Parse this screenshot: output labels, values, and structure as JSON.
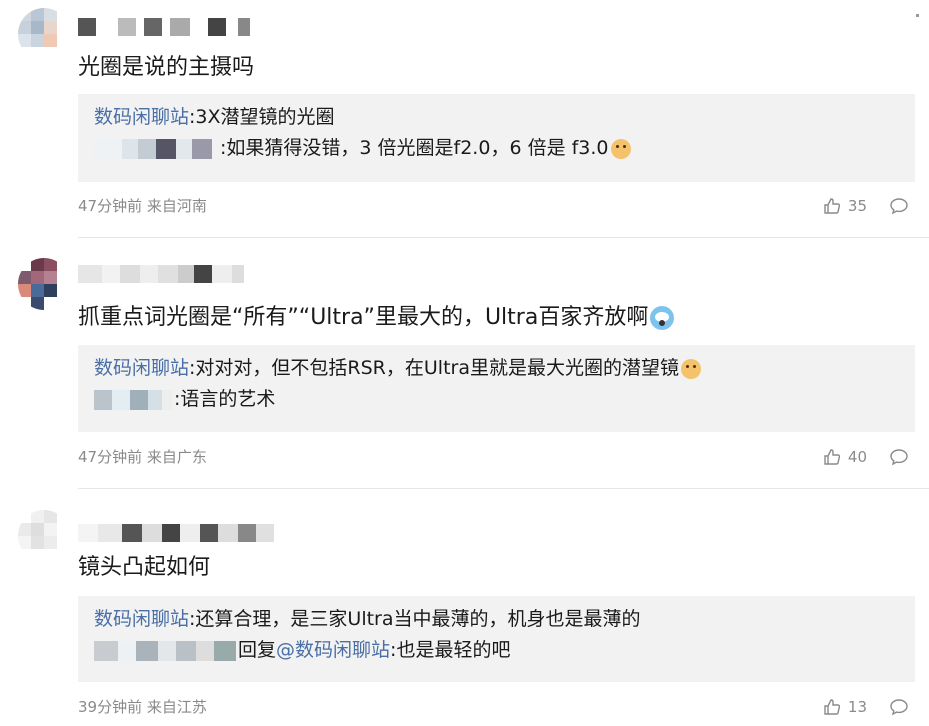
{
  "comments": [
    {
      "text": "光圈是说的主摄吗",
      "replies": [
        {
          "name": "数码闲聊站",
          "text": "3X潜望镜的光圈"
        },
        {
          "name": "",
          "text": "如果猜得没错，3 倍光圈是f2.0，6 倍是 f3.0",
          "emoji": "doge"
        }
      ],
      "time": "47分钟前 来自河南",
      "likes": "35"
    },
    {
      "text": "抓重点词光圈是“所有”“Ultra”里最大的，Ultra百家齐放啊",
      "emoji": "scared",
      "replies": [
        {
          "name": "数码闲聊站",
          "text": "对对对，但不包括RSR，在Ultra里就是最大光圈的潜望镜",
          "emoji": "doge"
        },
        {
          "name": "",
          "text": "语言的艺术"
        }
      ],
      "time": "47分钟前 来自广东",
      "likes": "40"
    },
    {
      "text": "镜头凸起如何",
      "replies": [
        {
          "name": "数码闲聊站",
          "text": "还算合理，是三家Ultra当中最薄的，机身也是最薄的"
        },
        {
          "name": "",
          "prefix": "回复",
          "mention": "@数码闲聊站",
          "text": "也是最轻的吧"
        }
      ],
      "time": "39分钟前 来自江苏",
      "likes": "13"
    }
  ],
  "icons": {
    "like": "thumbs-up-icon",
    "comment": "comment-bubble-icon"
  },
  "colors": {
    "link": "#4a6fa5",
    "reply_bg": "#f2f2f2",
    "meta": "#8a8a8a"
  }
}
